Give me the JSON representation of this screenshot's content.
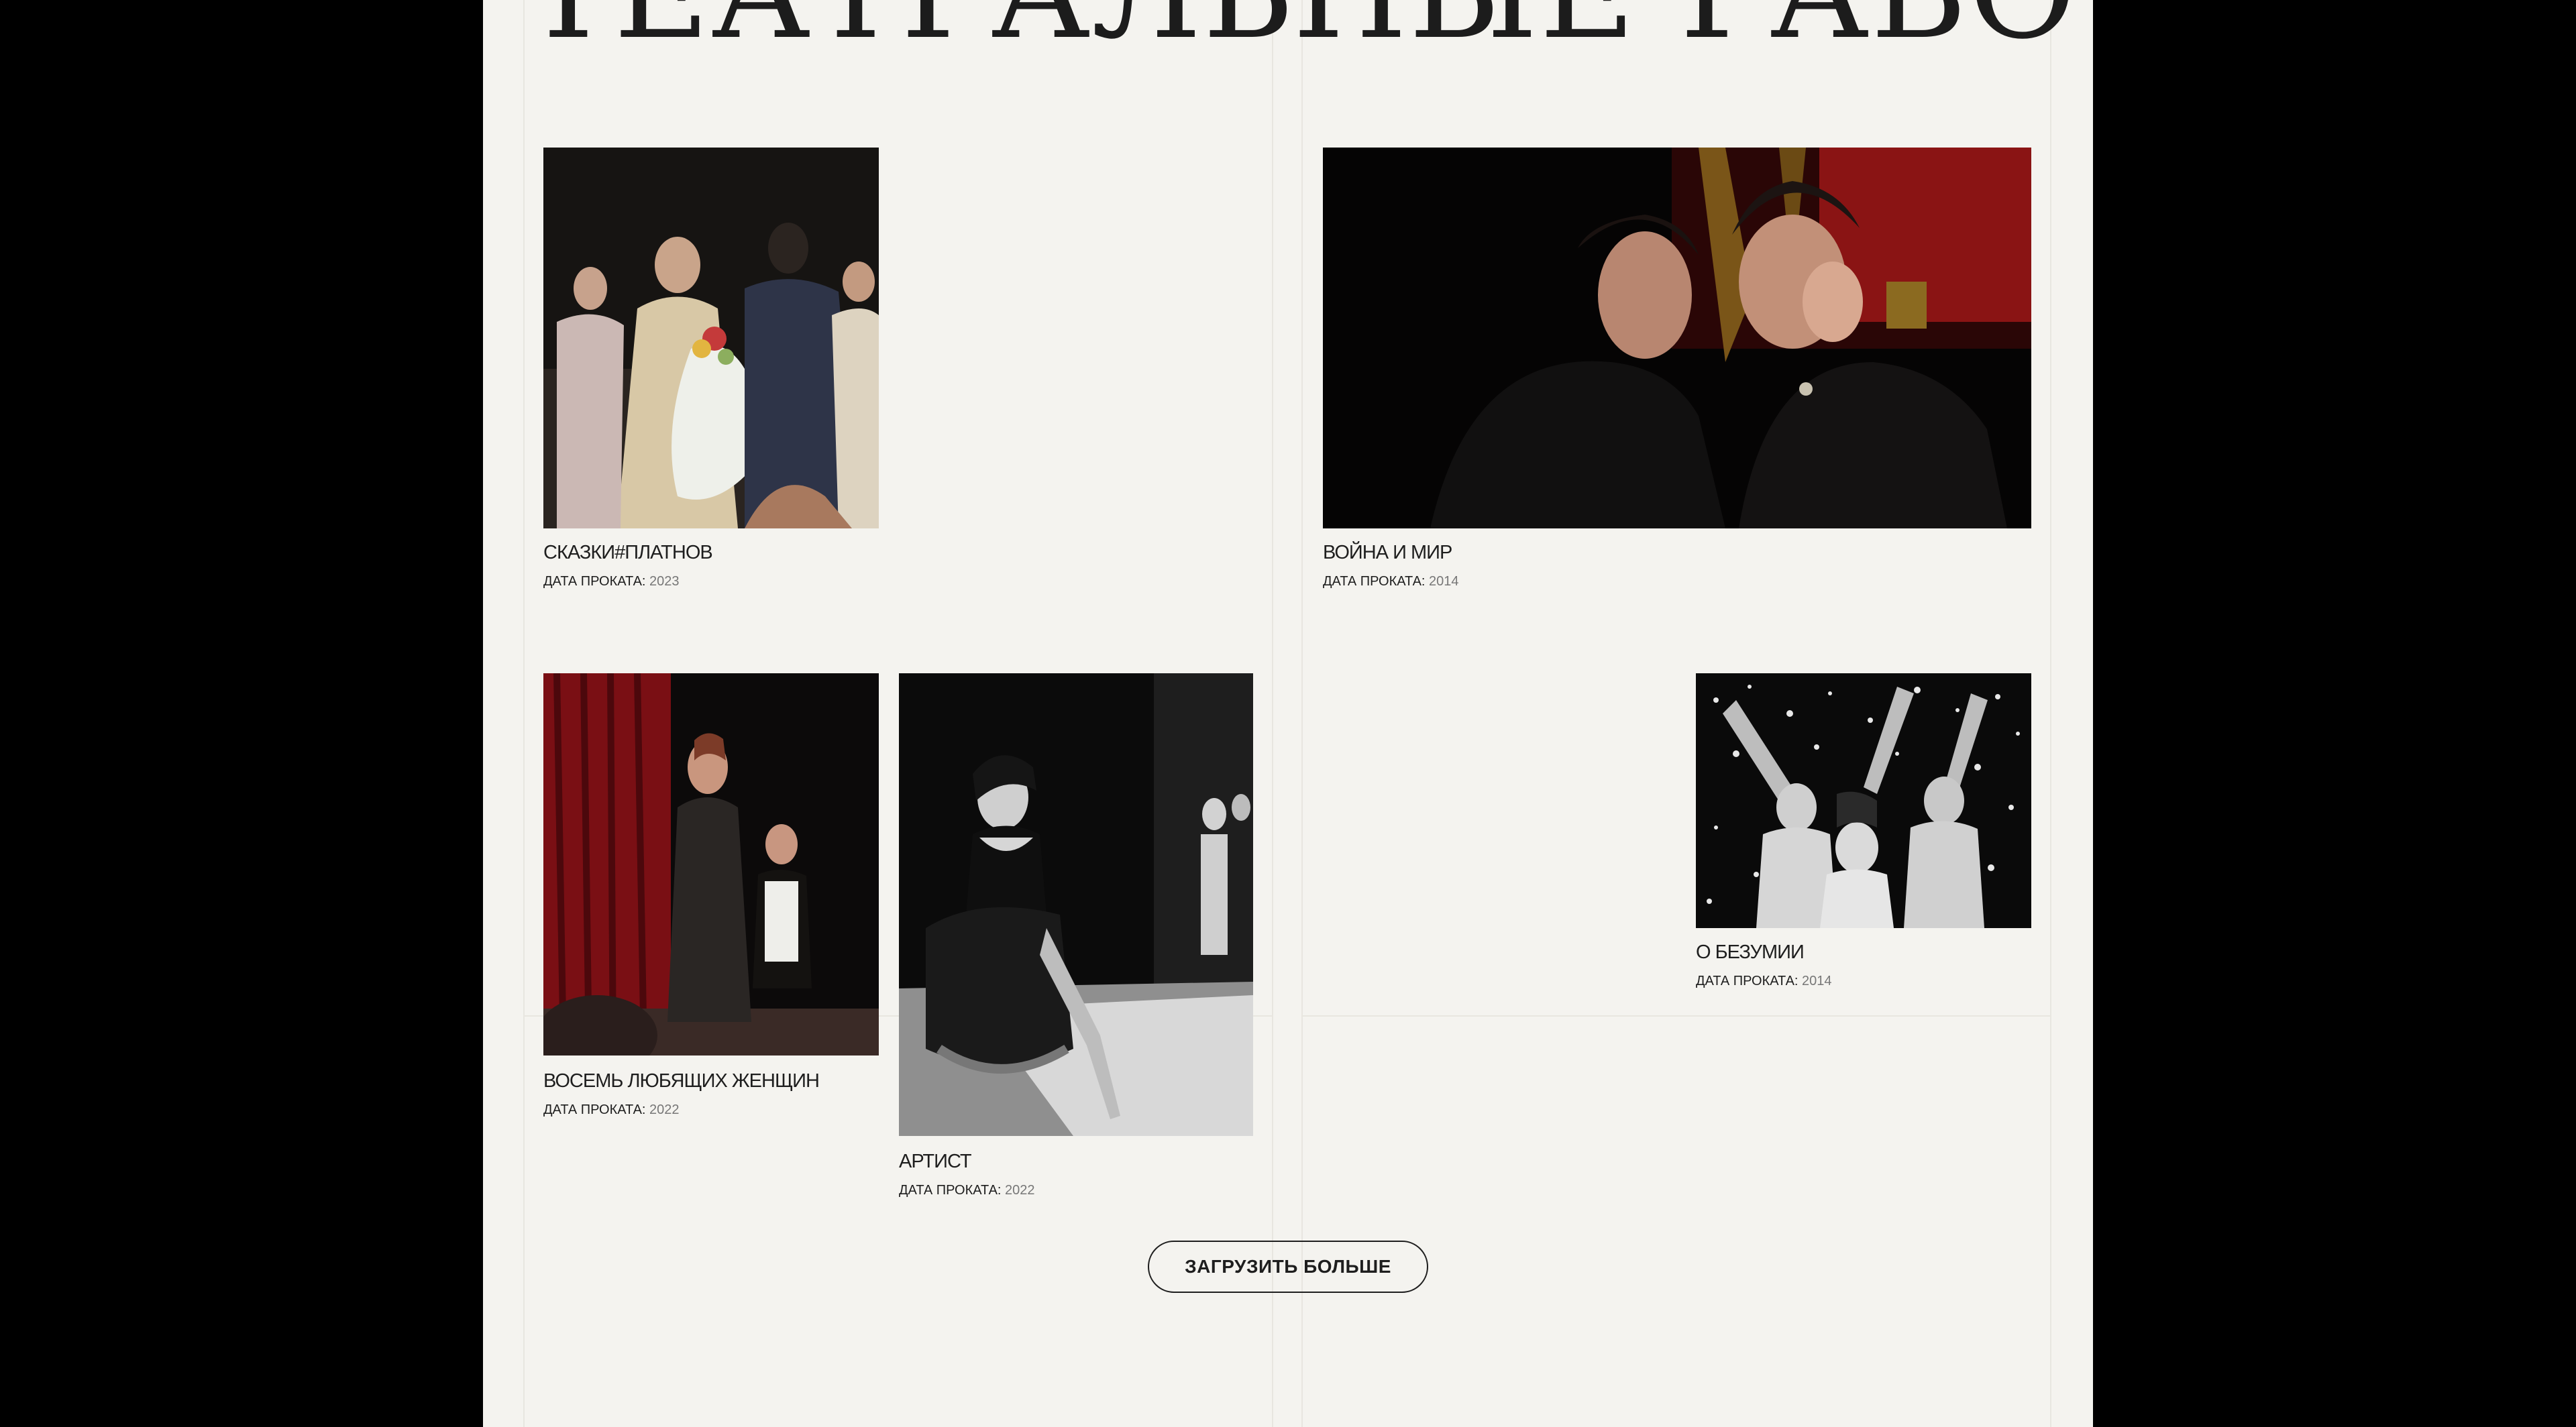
{
  "page": {
    "title": "ТЕАТРАЛЬНЫЕ РАБОТЫ"
  },
  "works": [
    {
      "title": "СКАЗКИ#ПЛАТНОВ",
      "date_label": "ДАТА ПРОКАТА:",
      "year": "2023"
    },
    {
      "title": "ВОЙНА И МИР",
      "date_label": "ДАТА ПРОКАТА:",
      "year": "2014"
    },
    {
      "title": "ВОСЕМЬ ЛЮБЯЩИХ ЖЕНЩИН",
      "date_label": "ДАТА ПРОКАТА:",
      "year": "2022"
    },
    {
      "title": "АРТИСТ",
      "date_label": "ДАТА ПРОКАТА:",
      "year": "2022"
    },
    {
      "title": "О БЕЗУМИИ",
      "date_label": "ДАТА ПРОКАТА:",
      "year": "2014"
    }
  ],
  "actions": {
    "load_more_label": "ЗАГРУЗИТЬ БОЛЬШЕ"
  }
}
